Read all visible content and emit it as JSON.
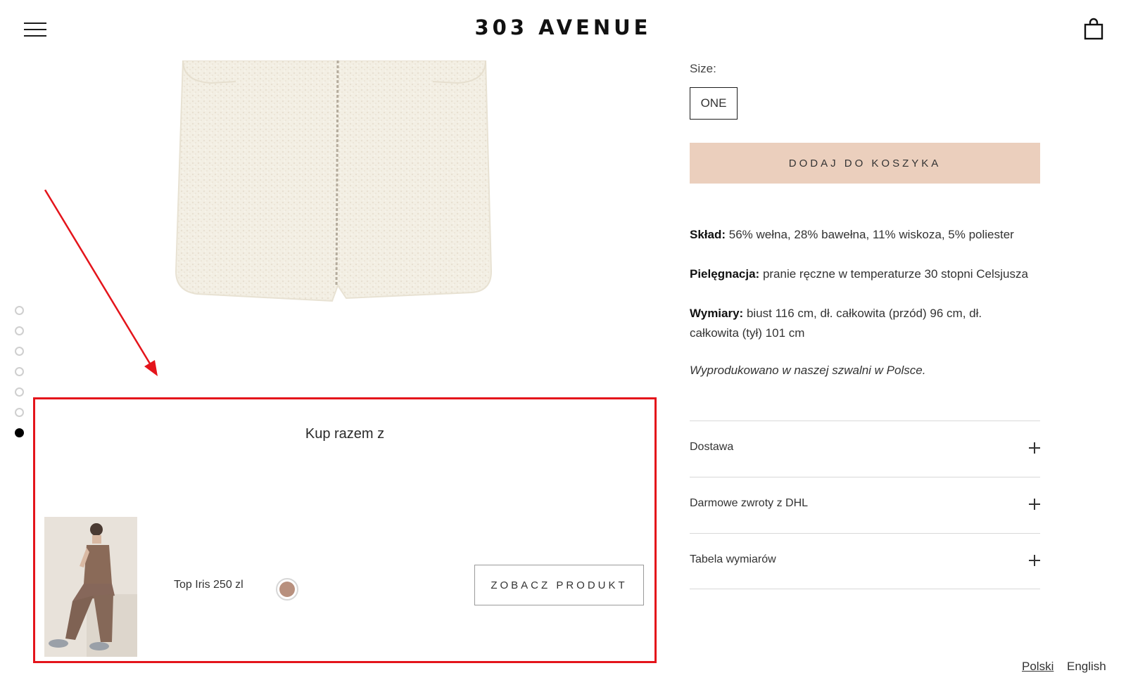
{
  "header": {
    "logo": "303 AVENUE",
    "menu_icon": "hamburger-menu-icon",
    "cart_icon": "shopping-bag-icon"
  },
  "gallery": {
    "slide_count": 7,
    "active_slide": 7
  },
  "bundle": {
    "title": "Kup razem z",
    "product_name": "Top Iris",
    "product_price": "250 zl",
    "product_label": "Top Iris 250 zl",
    "swatch_color": "#b8907e",
    "view_button_label": "ZOBACZ PRODUKT",
    "highlight_color": "#e4141b"
  },
  "product": {
    "size_label": "Size:",
    "size_option": "ONE",
    "add_to_cart_label": "DODAJ DO KOSZYKA",
    "add_to_cart_color": "#ebcfbd",
    "composition_label": "Skład:",
    "composition_value": " 56% wełna, 28% bawełna, 11% wiskoza, 5% poliester",
    "care_label": "Pielęgnacja:",
    "care_value": " pranie ręczne w temperaturze 30 stopni Celsjusza",
    "dimensions_label": "Wymiary:",
    "dimensions_value": " biust 116 cm, dł. całkowita (przód) 96 cm, dł. całkowita (tył) 101 cm",
    "made_in": "Wyprodukowano w naszej szwalni w Polsce."
  },
  "accordion": [
    {
      "label": "Dostawa"
    },
    {
      "label": "Darmowe zwroty z DHL"
    },
    {
      "label": "Tabela wymiarów"
    }
  ],
  "languages": {
    "polish": "Polski",
    "english": "English",
    "active": "Polski"
  }
}
